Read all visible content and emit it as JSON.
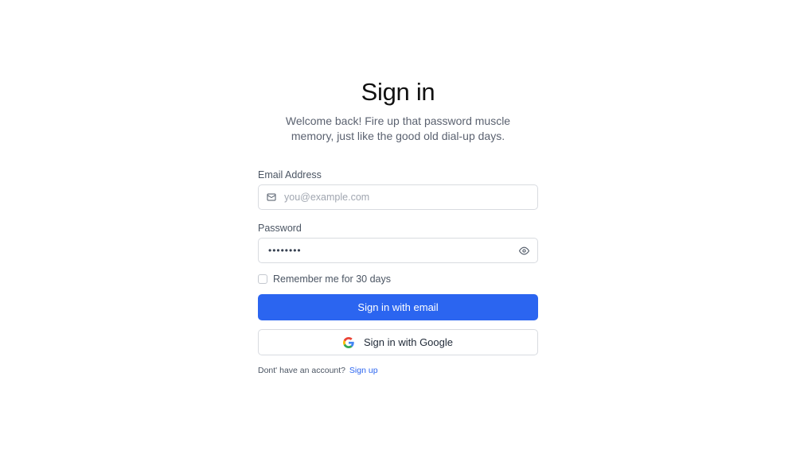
{
  "header": {
    "title": "Sign in",
    "subtitle": "Welcome back! Fire up that password muscle memory, just like the good old dial-up days."
  },
  "email": {
    "label": "Email Address",
    "placeholder": "you@example.com",
    "value": "",
    "icon": "mail-icon"
  },
  "password": {
    "label": "Password",
    "value": "password",
    "toggle_icon": "eye-icon"
  },
  "remember": {
    "label": "Remember me for 30 days",
    "checked": false
  },
  "actions": {
    "email_button": "Sign in with email",
    "google_button": "Sign in with Google",
    "google_icon": "google-icon",
    "primary_color": "#2b65f0"
  },
  "footer": {
    "prompt": "Dont' have an account?",
    "link": "Sign up"
  }
}
